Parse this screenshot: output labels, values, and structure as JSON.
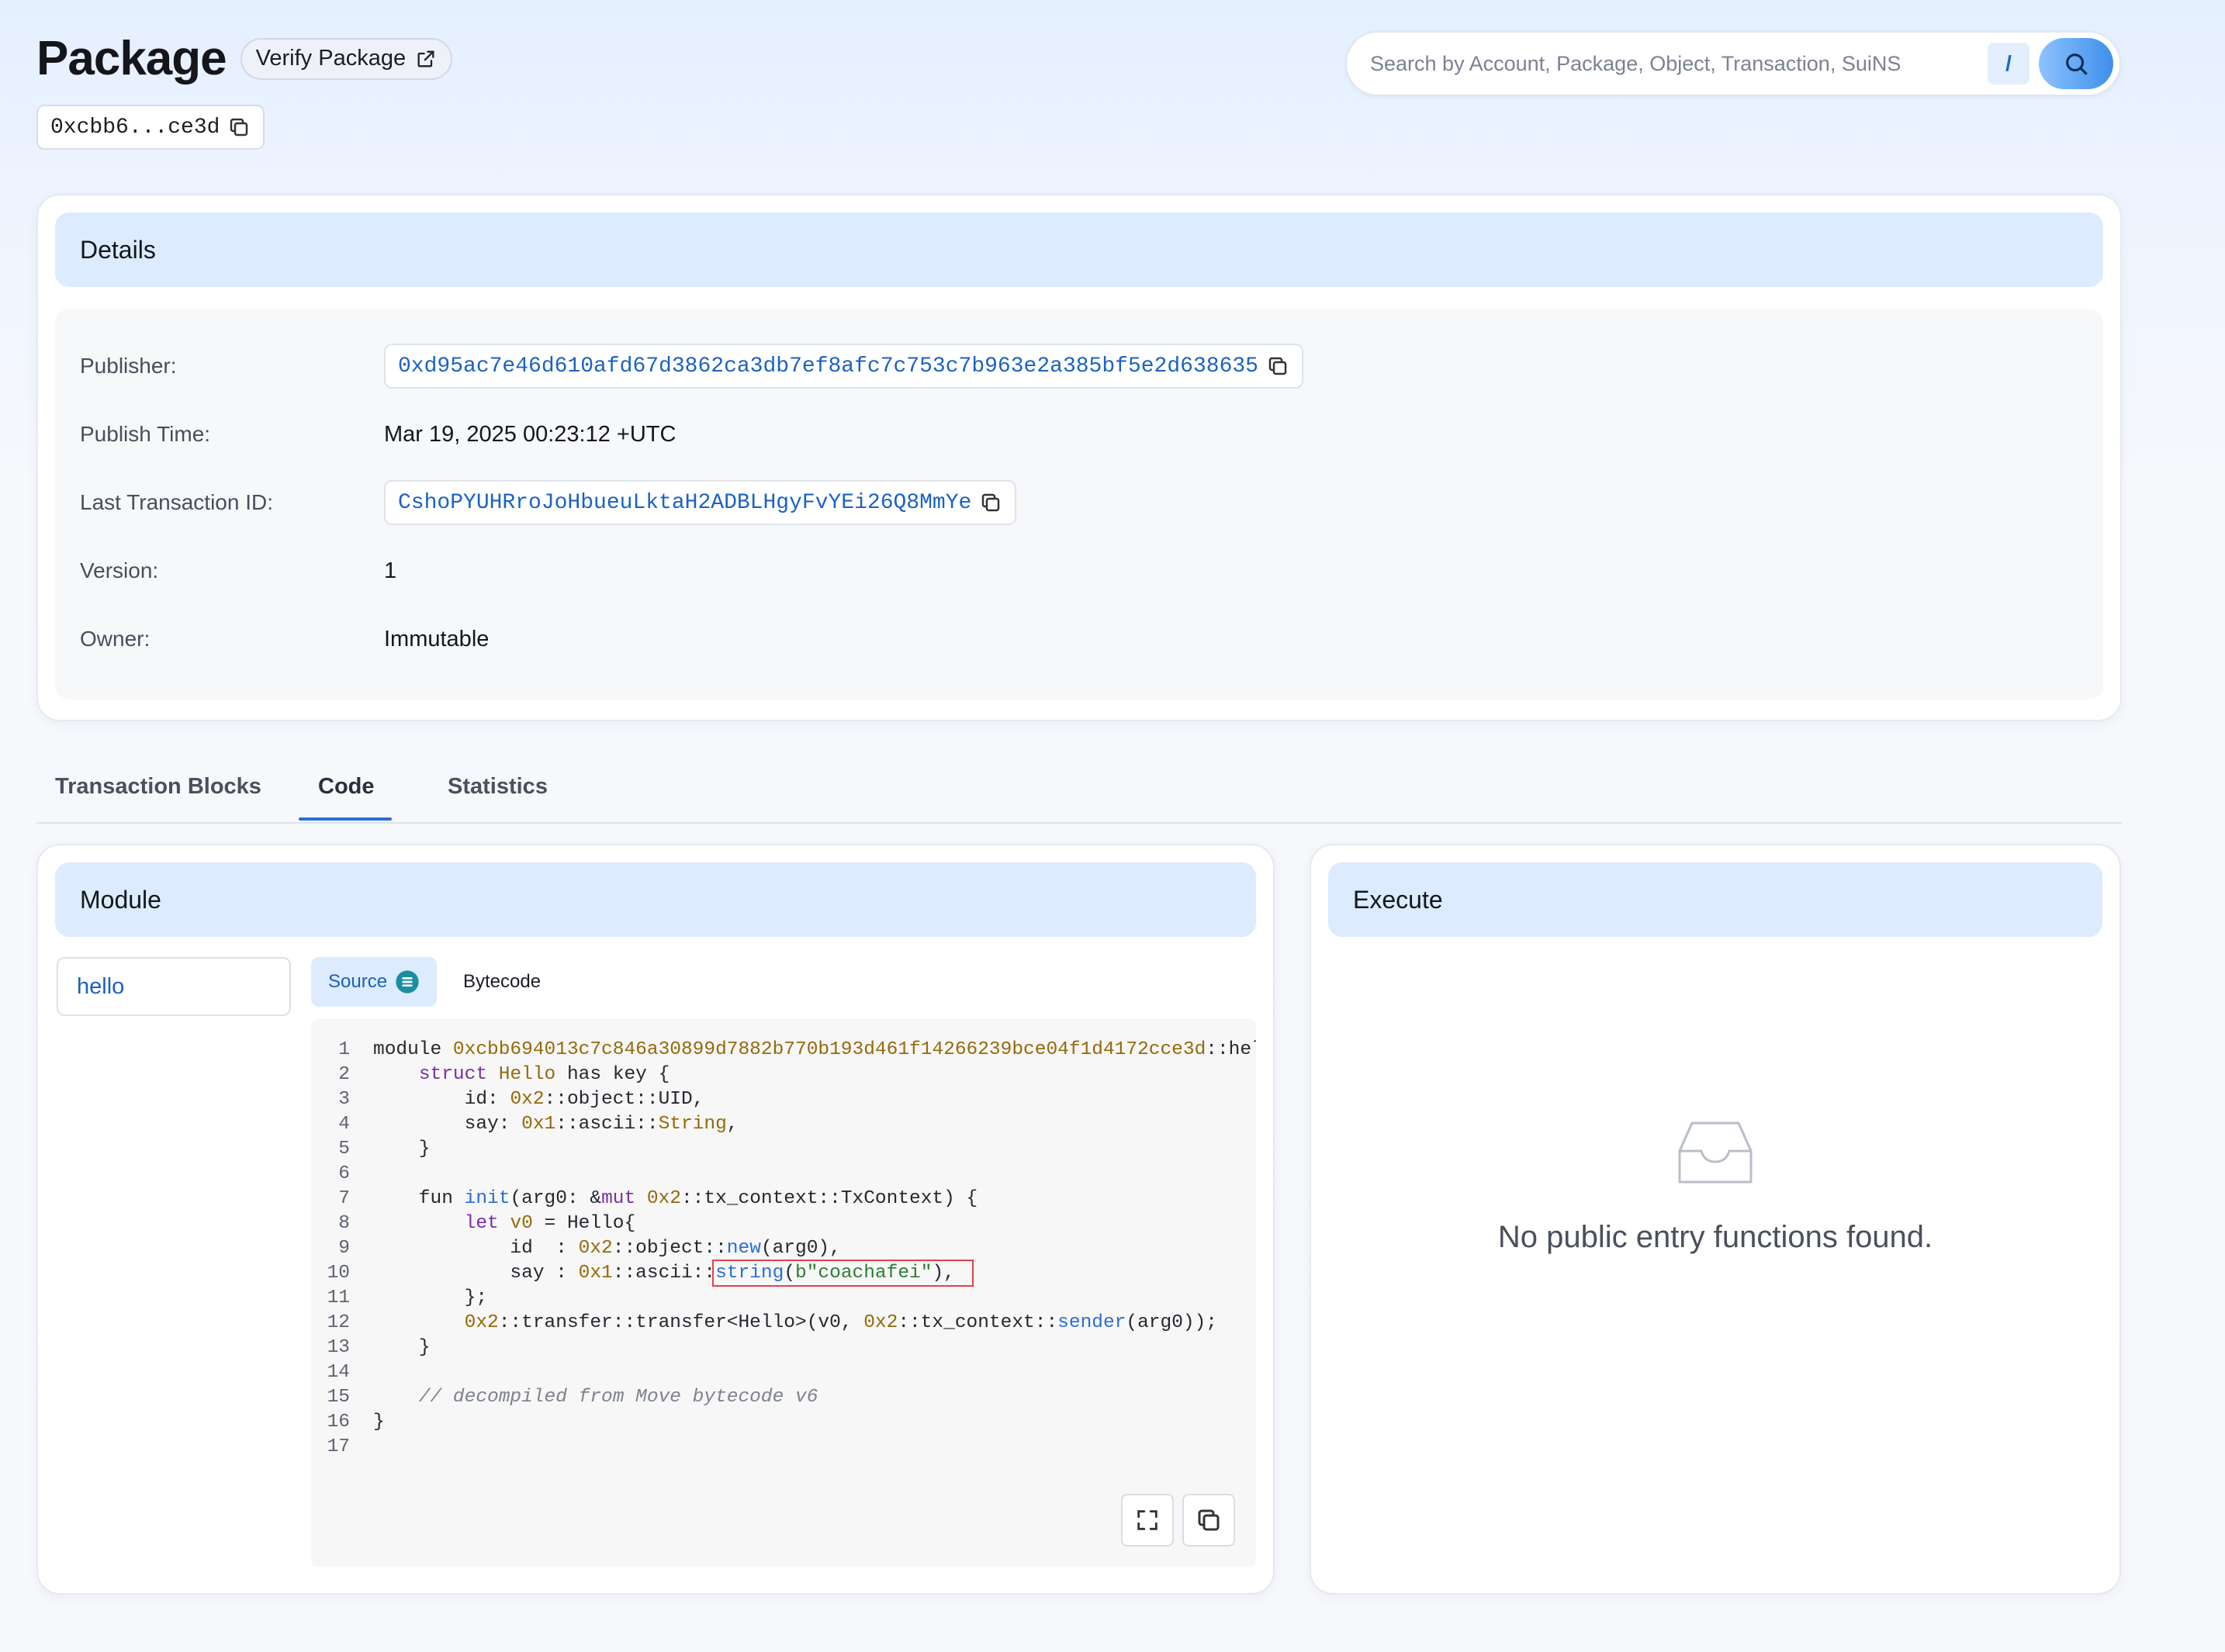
{
  "header": {
    "title": "Package",
    "verify_label": "Verify Package",
    "address_short": "0xcbb6...ce3d"
  },
  "search": {
    "placeholder": "Search by Account, Package, Object, Transaction, SuiNS",
    "shortcut_key": "/"
  },
  "details": {
    "title": "Details",
    "rows": [
      {
        "label": "Publisher:",
        "value": "0xd95ac7e46d610afd67d3862ca3db7ef8afc7c753c7b963e2a385bf5e2d638635"
      },
      {
        "label": "Publish Time:",
        "value": "Mar 19, 2025 00:23:12 +UTC"
      },
      {
        "label": "Last Transaction ID:",
        "value": "CshoPYUHRroJoHbueuLktaH2ADBLHgyFvYEi26Q8MmYe"
      },
      {
        "label": "Version:",
        "value": "1"
      },
      {
        "label": "Owner:",
        "value": "Immutable"
      }
    ]
  },
  "tabs": [
    {
      "label": "Transaction Blocks"
    },
    {
      "label": "Code"
    },
    {
      "label": "Statistics"
    }
  ],
  "active_tab": "Code",
  "module": {
    "title": "Module",
    "selected_module": "hello",
    "source_label": "Source",
    "bytecode_label": "Bytecode"
  },
  "code": {
    "module_address": "0xcbb694013c7c846a30899d7882b770b193d461f14266239bce04f1d4172cce3d",
    "say_value": "coachafei",
    "comment": "// decompiled from Move bytecode v6",
    "line_count": 17
  },
  "execute": {
    "title": "Execute",
    "empty_message": "No public entry functions found."
  },
  "colors": {
    "accent": "#2a6fd6",
    "header_band": "#dcebfd",
    "link": "#1c62c2",
    "highlight_box": "#e8404c"
  }
}
